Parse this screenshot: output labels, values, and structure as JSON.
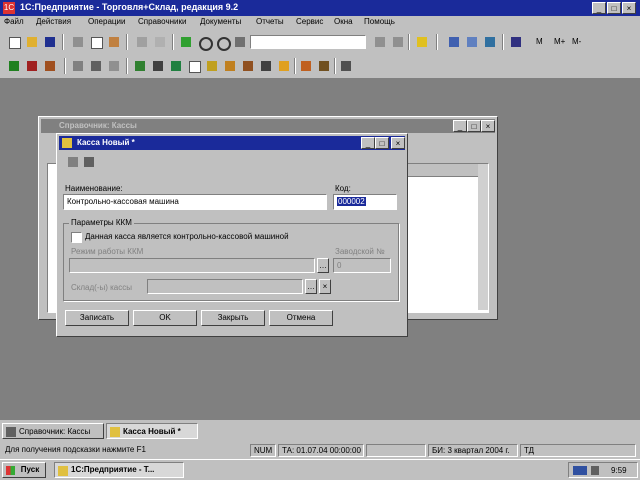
{
  "app": {
    "title": "1С:Предприятие - Торговля+Склад, редакция 9.2",
    "icon_text": "1С"
  },
  "menu": [
    "Файл",
    "Действия",
    "Операции",
    "Справочники",
    "Документы",
    "Отчеты",
    "Сервис",
    "Окна",
    "Помощь"
  ],
  "toolbar": {
    "page_indicators": [
      "M",
      "M+",
      "M-"
    ]
  },
  "list_window": {
    "title": "Справочник: Кассы"
  },
  "dialog": {
    "title": "Касса Новый *",
    "name_label": "Наименование:",
    "name_value": "Контрольно-кассовая машина",
    "code_label": "Код:",
    "code_value": "000002",
    "group_label": "Параметры ККМ",
    "checkbox_label": "Данная касса является контрольно-кассовой машиной",
    "mode_label": "Режим работы ККМ",
    "number_label": "Заводской №",
    "number_value": "0",
    "reserve_label": "Склад(-ы) кассы",
    "buttons": {
      "save": "Записать",
      "ok": "OK",
      "close": "Закрыть",
      "cancel": "Отмена"
    }
  },
  "tabs": [
    "Справочник: Кассы",
    "Касса Новый *"
  ],
  "status": {
    "hint": "Для получения подсказки нажмите F1",
    "num": "NUM",
    "ta": "ТА: 01.07.04 00:00:00",
    "bi": "БИ: 3 квартал 2004 г.",
    "t": "ТД"
  },
  "taskbar": {
    "start": "Пуск",
    "task": "1С:Предприятие - Т...",
    "clock": "9:59"
  }
}
